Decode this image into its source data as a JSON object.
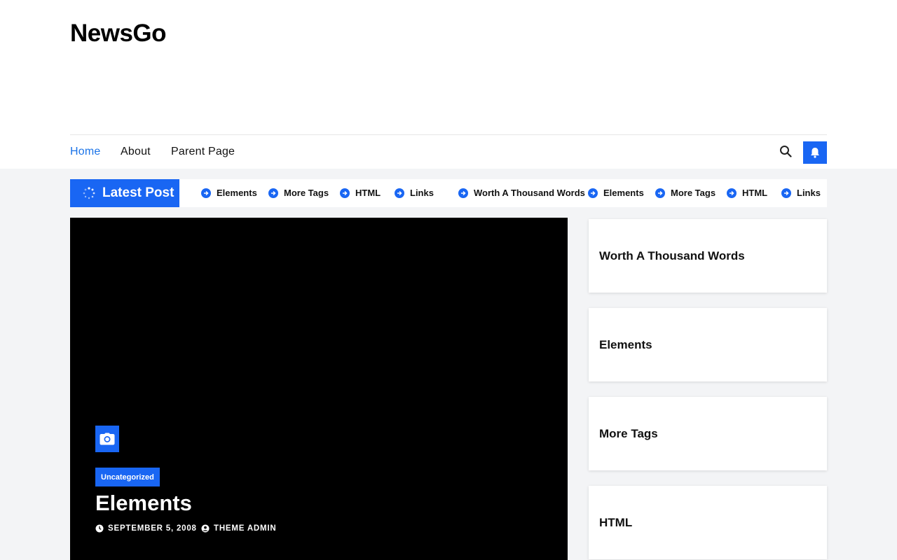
{
  "site": {
    "title": "NewsGo"
  },
  "nav": {
    "items": [
      {
        "label": "Home"
      },
      {
        "label": "About"
      },
      {
        "label": "Parent Page"
      }
    ]
  },
  "ticker": {
    "label": "Latest Post",
    "items": [
      "Elements",
      "More Tags",
      "HTML",
      "Links",
      "Worth A Thousand Words",
      "Elements",
      "More Tags",
      "HTML",
      "Links"
    ]
  },
  "hero": {
    "category": "Uncategorized",
    "title": "Elements",
    "date": "SEPTEMBER 5, 2008",
    "author": "THEME ADMIN"
  },
  "sidebar": {
    "posts": [
      {
        "title": "Worth A Thousand Words"
      },
      {
        "title": "Elements"
      },
      {
        "title": "More Tags"
      },
      {
        "title": "HTML"
      }
    ]
  },
  "colors": {
    "accent": "#1966f3",
    "nav_active": "#1a73e8",
    "band": "#f3f4f6"
  }
}
